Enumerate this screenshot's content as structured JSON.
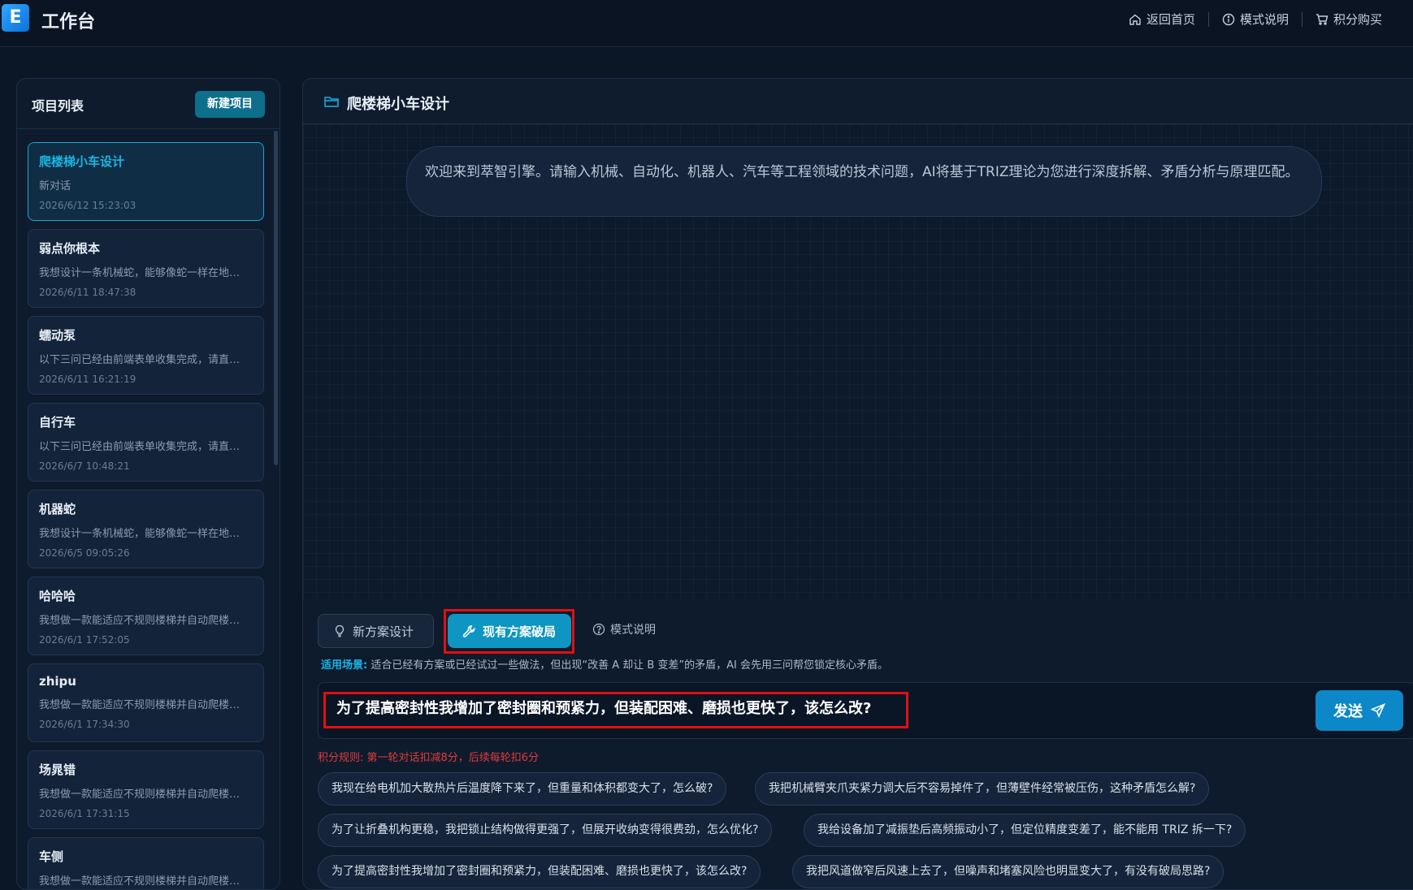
{
  "header": {
    "logo_letter": "E",
    "title": "工作台",
    "nav": [
      {
        "label": "返回首页",
        "icon": "home-icon"
      },
      {
        "label": "模式说明",
        "icon": "info-icon"
      },
      {
        "label": "积分购买",
        "icon": "cart-icon"
      }
    ]
  },
  "sidebar": {
    "title": "项目列表",
    "new_button": "新建项目",
    "projects": [
      {
        "name": "爬楼梯小车设计",
        "desc": "新对话",
        "date": "2026/6/12 15:23:03",
        "active": true
      },
      {
        "name": "弱点你根本",
        "desc": "我想设计一条机械蛇，能够像蛇一样在地…",
        "date": "2026/6/11 18:47:38"
      },
      {
        "name": "蠕动泵",
        "desc": "以下三问已经由前端表单收集完成，请直…",
        "date": "2026/6/11 16:21:19"
      },
      {
        "name": "自行车",
        "desc": "以下三问已经由前端表单收集完成，请直…",
        "date": "2026/6/7 10:48:21"
      },
      {
        "name": "机器蛇",
        "desc": "我想设计一条机械蛇，能够像蛇一样在地…",
        "date": "2026/6/5 09:05:26"
      },
      {
        "name": "哈哈哈",
        "desc": "我想做一款能适应不规则楼梯并自动爬楼…",
        "date": "2026/6/1 17:52:05"
      },
      {
        "name": "zhipu",
        "desc": "我想做一款能适应不规则楼梯并自动爬楼…",
        "date": "2026/6/1 17:34:30"
      },
      {
        "name": "场晁错",
        "desc": "我想做一款能适应不规则楼梯并自动爬楼…",
        "date": "2026/6/1 17:31:15"
      },
      {
        "name": "车侧",
        "desc": "我想做一款能适应不规则楼梯并自动爬楼…",
        "date": ""
      }
    ]
  },
  "main": {
    "title": "爬楼梯小车设计",
    "welcome": "欢迎来到萃智引擎。请输入机械、自动化、机器人、汽车等工程领域的技术问题，AI将基于TRIZ理论为您进行深度拆解、矛盾分析与原理匹配。",
    "modes": {
      "new_design": "新方案设计",
      "existing_break": "现有方案破局",
      "help": "模式说明"
    },
    "scene_label": "适用场景:",
    "scene_text": "适合已经有方案或已经试过一些做法，但出现“改善 A 却让 B 变差”的矛盾，AI 会先用三问帮您锁定核心矛盾。",
    "input_value": "为了提高密封性我增加了密封圈和预紧力，但装配困难、磨损也更快了，该怎么改?",
    "send_label": "发送",
    "points_rule": "积分规则: 第一轮对话扣减8分，后续每轮扣6分",
    "suggestions": [
      "我现在给电机加大散热片后温度降下来了，但重量和体积都变大了，怎么破?",
      "我把机械臂夹爪夹紧力调大后不容易掉件了，但薄壁件经常被压伤，这种矛盾怎么解?",
      "为了让折叠机构更稳，我把锁止结构做得更强了，但展开收纳变得很费劲，怎么优化?",
      "我给设备加了减振垫后高频振动小了，但定位精度变差了，能不能用 TRIZ 拆一下?",
      "为了提高密封性我增加了密封圈和预紧力，但装配困难、磨损也更快了，该怎么改?",
      "我把风道做窄后风速上去了，但噪声和堵塞风险也明显变大了，有没有破局思路?"
    ]
  },
  "colors": {
    "accent": "#0f95c2",
    "active_text": "#19b7e6",
    "highlight_outline": "#e01010",
    "rule_text": "#e03b3b"
  }
}
